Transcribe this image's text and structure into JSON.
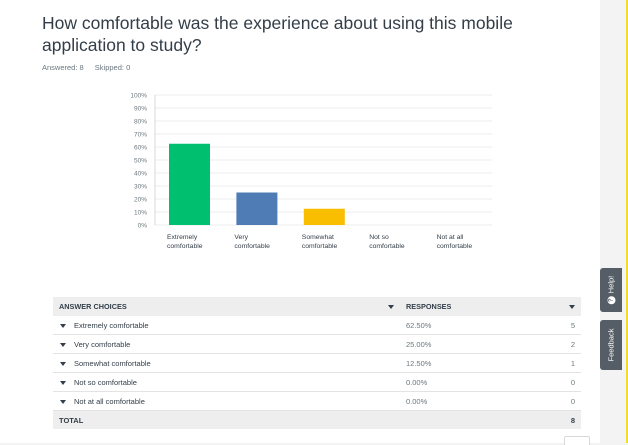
{
  "question": {
    "title": "How comfortable was the experience about using this mobile application to study?",
    "answered_label": "Answered: 8",
    "skipped_label": "Skipped: 0"
  },
  "chart_data": {
    "type": "bar",
    "categories": [
      [
        "Extremely",
        "comfortable"
      ],
      [
        "Very",
        "comfortable"
      ],
      [
        "Somewhat",
        "comfortable"
      ],
      [
        "Not so",
        "comfortable"
      ],
      [
        "Not at all",
        "comfortable"
      ]
    ],
    "values": [
      62.5,
      25.0,
      12.5,
      0,
      0
    ],
    "colors": [
      "#00bf6f",
      "#507cb6",
      "#f9be00",
      "#6bc8cd",
      "#9b8ad5"
    ],
    "ylim": [
      0,
      100
    ],
    "yticks": [
      "0%",
      "10%",
      "20%",
      "30%",
      "40%",
      "50%",
      "60%",
      "70%",
      "80%",
      "90%",
      "100%"
    ],
    "grid": true
  },
  "table": {
    "header": {
      "choices": "ANSWER CHOICES",
      "responses": "RESPONSES"
    },
    "rows": [
      {
        "label": "Extremely comfortable",
        "percent": "62.50%",
        "count": "5"
      },
      {
        "label": "Very comfortable",
        "percent": "25.00%",
        "count": "2"
      },
      {
        "label": "Somewhat comfortable",
        "percent": "12.50%",
        "count": "1"
      },
      {
        "label": "Not so comfortable",
        "percent": "0.00%",
        "count": "0"
      },
      {
        "label": "Not at all comfortable",
        "percent": "0.00%",
        "count": "0"
      }
    ],
    "total": {
      "label": "TOTAL",
      "count": "8"
    }
  },
  "side_tabs": {
    "help": "Help!",
    "feedback": "Feedback"
  },
  "icons": {
    "help": "question-circle-icon",
    "sort": "caret-down-icon"
  }
}
